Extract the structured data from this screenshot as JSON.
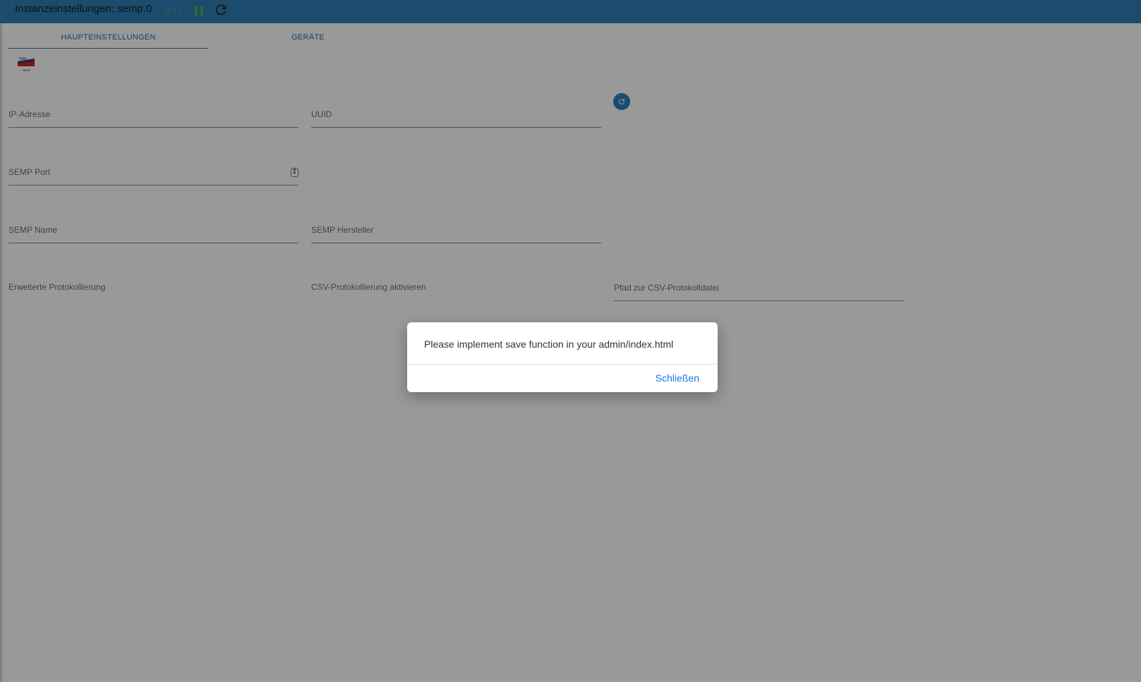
{
  "header": {
    "title": "Instanzeinstellungen: semp.0",
    "version": "v0.1.0",
    "pause_icon": "pause-icon",
    "reload_icon": "reload-icon",
    "bar_color": "#2e7fb8"
  },
  "tabs": [
    {
      "label": "HAUPTEINSTELLUNGEN",
      "active": true
    },
    {
      "label": "GERÄTE",
      "active": false
    }
  ],
  "logo": {
    "icon": "sma-semp-logo",
    "text_top": "SMA",
    "text_bottom": "SEMP"
  },
  "form": {
    "ip_address": {
      "label": "IP-Adresse",
      "value": ""
    },
    "uuid": {
      "label": "UUID",
      "value": ""
    },
    "semp_port": {
      "label": "SEMP Port",
      "value": ""
    },
    "semp_name": {
      "label": "SEMP Name",
      "value": ""
    },
    "semp_manufacturer": {
      "label": "SEMP Hersteller",
      "value": ""
    },
    "extended_logging": {
      "label": "Erweiterte Protokollierung"
    },
    "csv_logging": {
      "label": "CSV-Protokollierung aktivieren"
    },
    "csv_path": {
      "label": "Pfad zur CSV-Protokolldatei",
      "value": ""
    }
  },
  "uuid_refresh_icon": "refresh-icon",
  "dialog": {
    "message": "Please implement save function in your admin/index.html",
    "close_label": "Schließen"
  }
}
